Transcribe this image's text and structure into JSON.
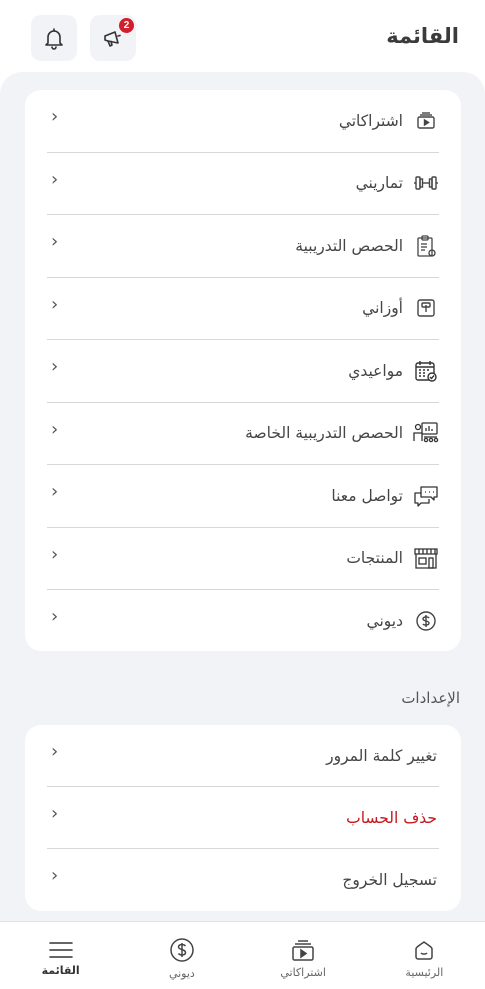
{
  "header": {
    "title": "القائمة",
    "notifications_icon": "bell-icon",
    "announcements_icon": "megaphone-icon",
    "announcements_badge": "2"
  },
  "menu": {
    "items": [
      {
        "label": "اشتراكاتي",
        "icon": "subscriptions-icon"
      },
      {
        "label": "تماريني",
        "icon": "dumbbell-icon"
      },
      {
        "label": "الحصص التدريبية",
        "icon": "clipboard-icon"
      },
      {
        "label": "أوزاني",
        "icon": "scale-icon"
      },
      {
        "label": "مواعيدي",
        "icon": "calendar-icon"
      },
      {
        "label": "الحصص التدريبية الخاصة",
        "icon": "private-class-icon"
      },
      {
        "label": "تواصل معنا",
        "icon": "chat-icon"
      },
      {
        "label": "المنتجات",
        "icon": "store-icon"
      },
      {
        "label": "ديوني",
        "icon": "dollar-icon"
      }
    ]
  },
  "settings": {
    "title": "الإعدادات",
    "items": [
      {
        "label": "تغيير كلمة المرور"
      },
      {
        "label": "حذف الحساب",
        "color": "#c4161c"
      },
      {
        "label": "تسجيل الخروج"
      }
    ]
  },
  "bottom_nav": {
    "items": [
      {
        "label": "القائمة",
        "icon": "menu-icon",
        "active": true
      },
      {
        "label": "ديوني",
        "icon": "dollar-icon"
      },
      {
        "label": "اشتراكاتي",
        "icon": "subscriptions-icon"
      },
      {
        "label": "الرئيسية",
        "icon": "home-icon"
      }
    ]
  },
  "colors": {
    "background": "#f2f3f7",
    "card": "#ffffff",
    "danger": "#c4161c",
    "badge": "#d21f2b"
  }
}
